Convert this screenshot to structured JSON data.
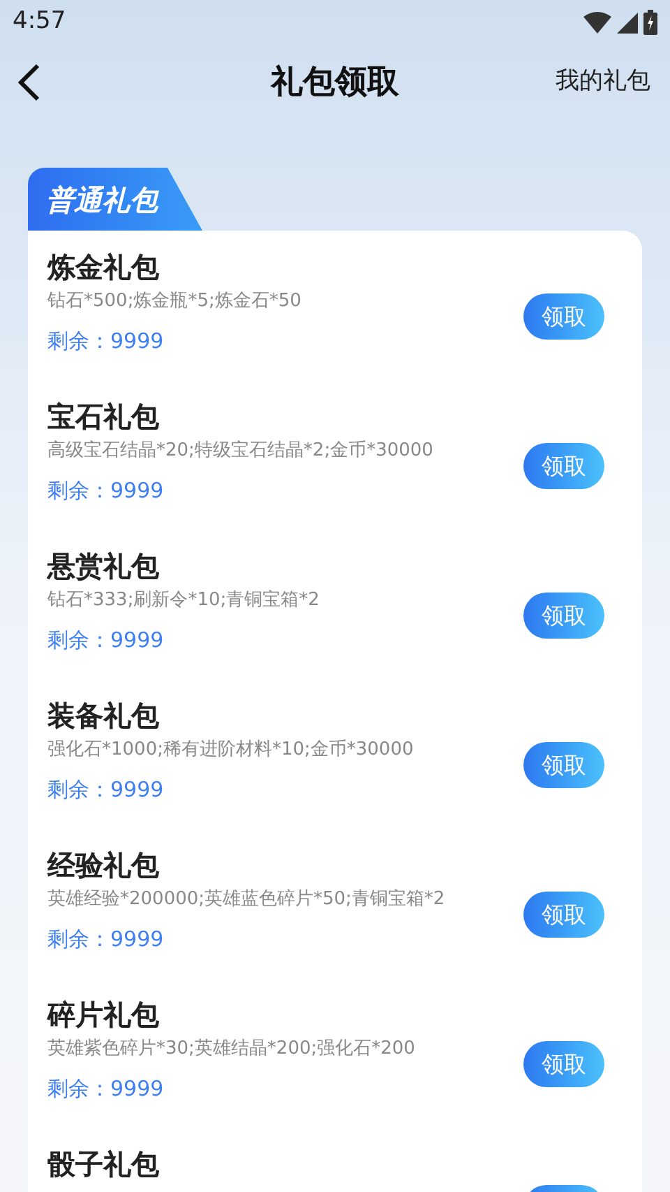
{
  "status_bar": {
    "time": "4:57"
  },
  "header": {
    "title": "礼包领取",
    "right_link": "我的礼包"
  },
  "section_tab": {
    "label": "普通礼包"
  },
  "gifts": [
    {
      "title": "炼金礼包",
      "contents": "钻石*500;炼金瓶*5;炼金石*50",
      "remaining": "剩余：9999",
      "button": "领取"
    },
    {
      "title": "宝石礼包",
      "contents": "高级宝石结晶*20;特级宝石结晶*2;金币*30000",
      "remaining": "剩余：9999",
      "button": "领取"
    },
    {
      "title": "悬赏礼包",
      "contents": "钻石*333;刷新令*10;青铜宝箱*2",
      "remaining": "剩余：9999",
      "button": "领取"
    },
    {
      "title": "装备礼包",
      "contents": "强化石*1000;稀有进阶材料*10;金币*30000",
      "remaining": "剩余：9999",
      "button": "领取"
    },
    {
      "title": "经验礼包",
      "contents": "英雄经验*200000;英雄蓝色碎片*50;青铜宝箱*2",
      "remaining": "剩余：9999",
      "button": "领取"
    },
    {
      "title": "碎片礼包",
      "contents": "英雄紫色碎片*30;英雄结晶*200;强化石*200",
      "remaining": "剩余：9999",
      "button": "领取"
    },
    {
      "title": "骰子礼包"
    }
  ]
}
